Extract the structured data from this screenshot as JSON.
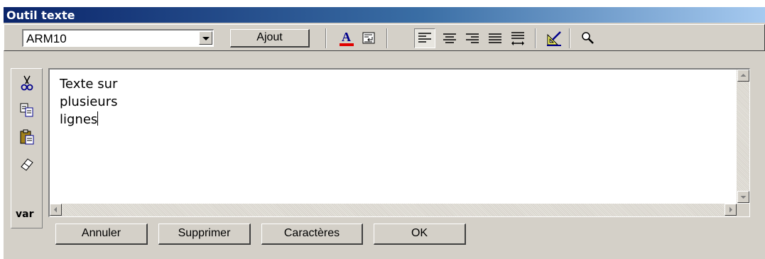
{
  "window": {
    "title": "Outil texte"
  },
  "toolbar": {
    "font_select": "ARM10",
    "add_label": "Ajout",
    "icons": [
      "text-color-icon",
      "insert-field-icon",
      "align-left-icon",
      "align-center-icon",
      "align-right-icon",
      "justify-icon",
      "fit-width-icon",
      "edit-style-icon",
      "zoom-icon"
    ]
  },
  "sidebar": {
    "icons": [
      "cut-icon",
      "copy-icon",
      "paste-icon",
      "eraser-icon"
    ],
    "var_label": "var"
  },
  "editor": {
    "lines": [
      "Texte sur",
      "plusieurs",
      "lignes"
    ]
  },
  "buttons": {
    "cancel": "Annuler",
    "delete": "Supprimer",
    "characters": "Caractères",
    "ok": "OK"
  },
  "colors": {
    "title_start": "#0a246a",
    "title_end": "#a6caf0",
    "text_color_bar": "#e00000",
    "face": "#d4d0c8"
  }
}
